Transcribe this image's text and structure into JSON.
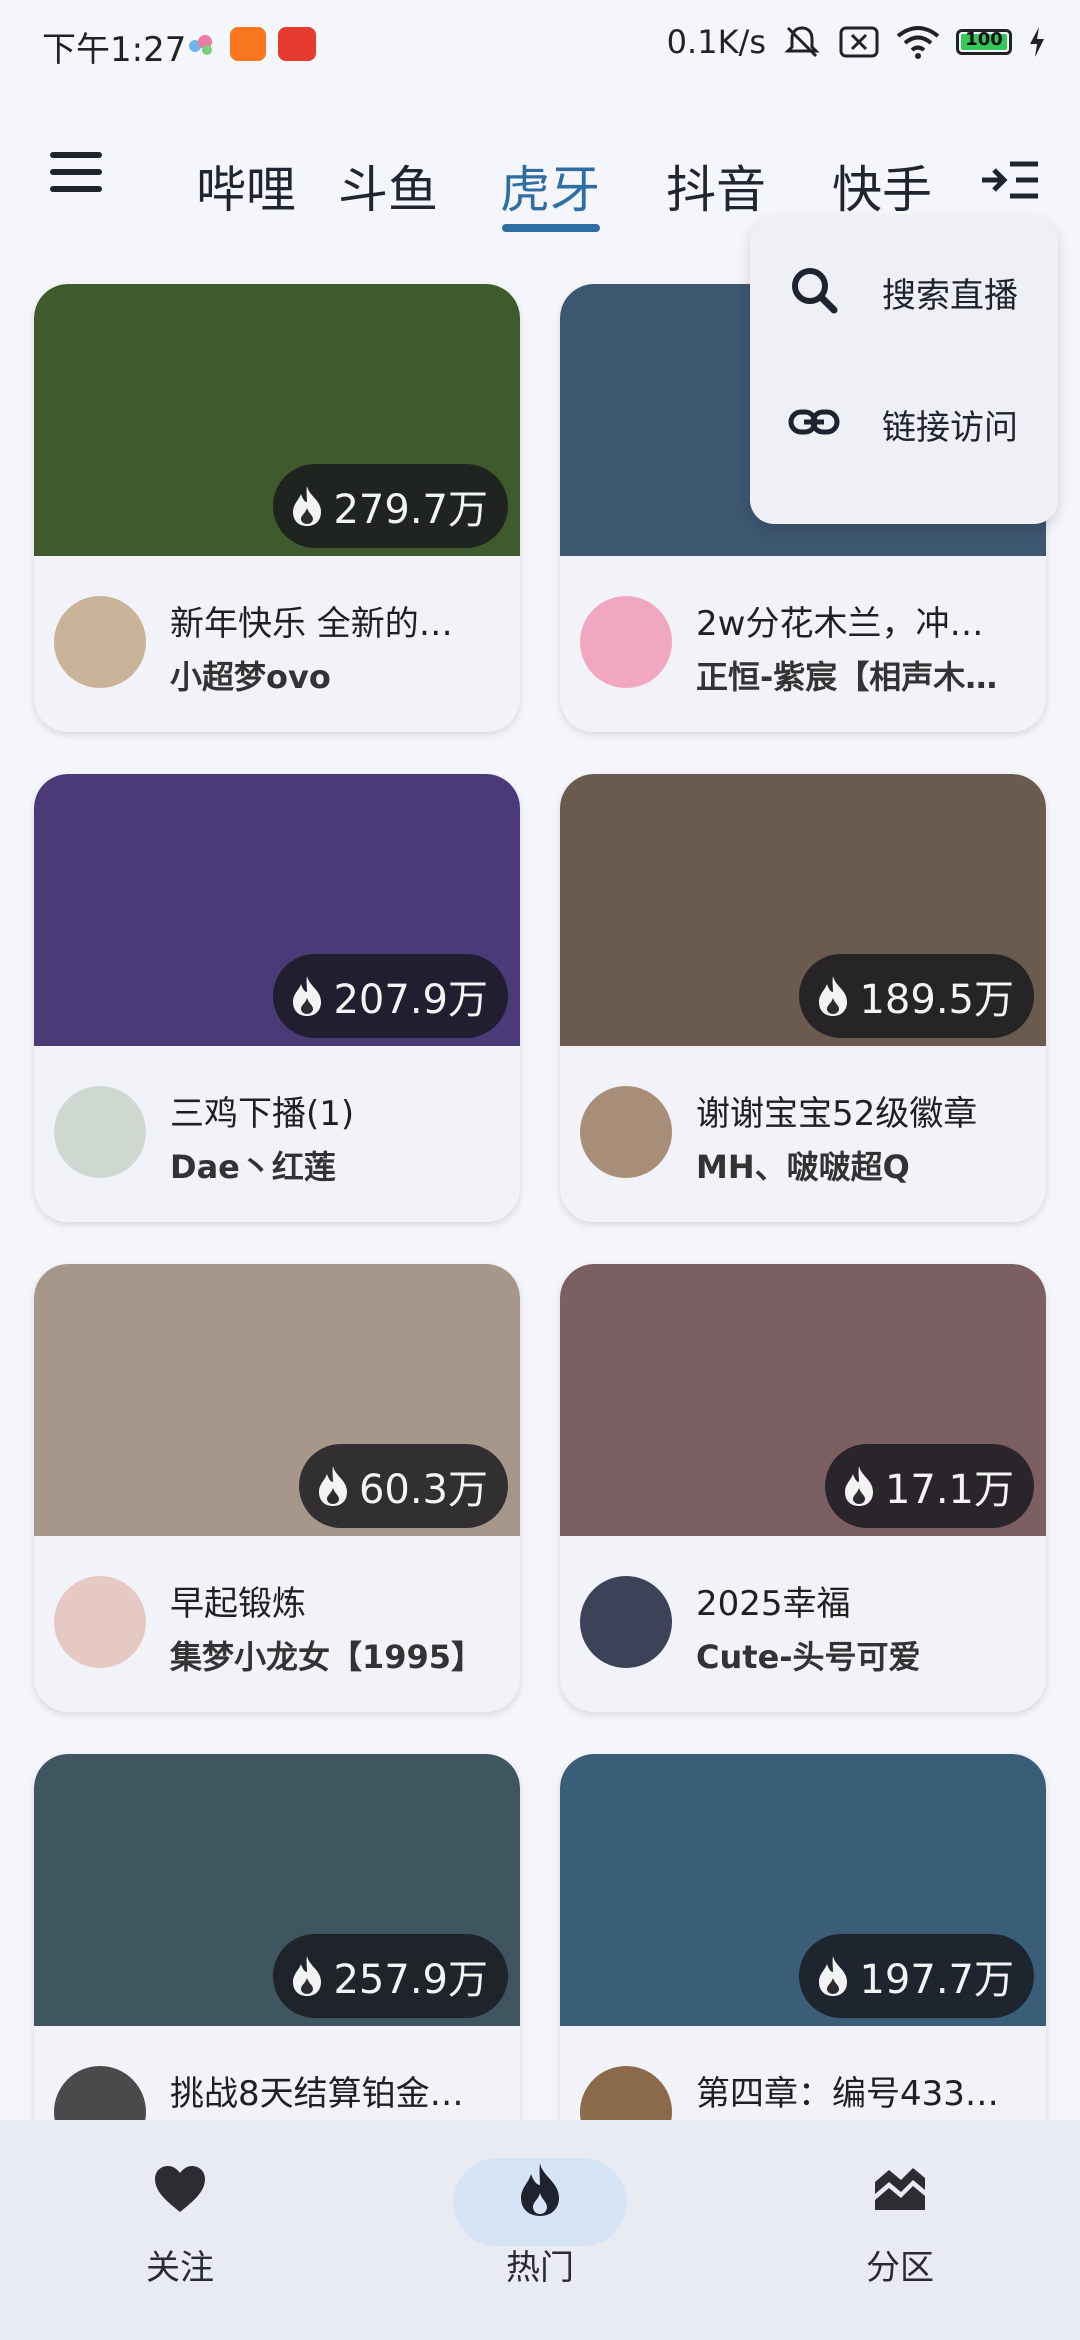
{
  "status_bar": {
    "time": "下午1:27",
    "net_speed": "0.1K/s",
    "battery": "100"
  },
  "top_tabs": [
    "哔哩",
    "斗鱼",
    "虎牙",
    "抖音",
    "快手"
  ],
  "active_tab": "虎牙",
  "popup_menu": {
    "items": [
      {
        "label": "搜索直播",
        "icon": "search-icon"
      },
      {
        "label": "链接访问",
        "icon": "link-icon"
      }
    ]
  },
  "cards": [
    {
      "title": "新年快乐 全新的…",
      "author": "小超梦ovo",
      "viewers": "279.7万",
      "thumb_color": "#3f5a2c",
      "avatar_color": "#c9b49a"
    },
    {
      "title": "2w分花木兰，冲…",
      "author": "正恒-紫宸【相声木…",
      "viewers": "",
      "thumb_color": "#3d5770",
      "avatar_color": "#f2a7c0"
    },
    {
      "title": "三鸡下播(1)",
      "author": "Dae丶红莲",
      "viewers": "207.9万",
      "thumb_color": "#4b3a78",
      "avatar_color": "#cfd9d2"
    },
    {
      "title": "谢谢宝宝52级徽章",
      "author": "MH、啵啵超Q",
      "viewers": "189.5万",
      "thumb_color": "#6b5a4e",
      "avatar_color": "#a88e78"
    },
    {
      "title": "早起锻炼",
      "author": "集梦小龙女【1995】",
      "viewers": "60.3万",
      "thumb_color": "#a7968a",
      "avatar_color": "#e6c9c2"
    },
    {
      "title": "2025幸福",
      "author": "Cute-头号可爱",
      "viewers": "17.1万",
      "thumb_color": "#7c5f62",
      "avatar_color": "#3c4258"
    },
    {
      "title": "挑战8天结算铂金…",
      "author": "",
      "viewers": "257.9万",
      "thumb_color": "#3f5560",
      "avatar_color": "#4a4a4a"
    },
    {
      "title": "第四章：编号433…",
      "author": "",
      "viewers": "197.7万",
      "thumb_color": "#3a5e78",
      "avatar_color": "#8a6a4a"
    }
  ],
  "bottom_nav": [
    {
      "label": "关注",
      "icon": "heart-icon"
    },
    {
      "label": "热门",
      "icon": "flame-icon"
    },
    {
      "label": "分区",
      "icon": "category-icon"
    }
  ],
  "active_nav": "热门",
  "colors": {
    "accent": "#2f6ea3",
    "nav_pill": "#d6e4f5",
    "background": "#f5f6fb"
  }
}
